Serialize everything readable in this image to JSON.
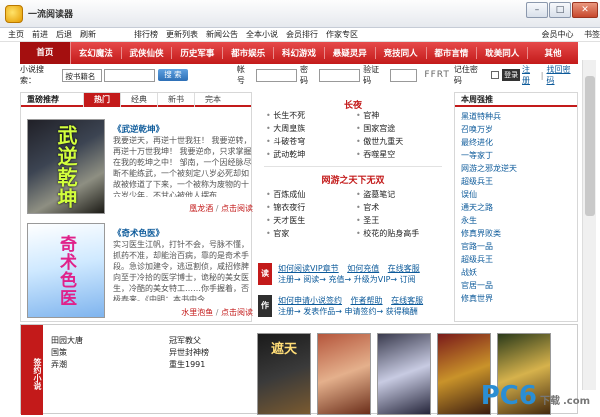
{
  "window": {
    "title": "一流阅读器"
  },
  "menubar": {
    "items": [
      "主页",
      "前进",
      "后退",
      "刷新",
      "排行榜",
      "更新列表",
      "新闻公告",
      "全本小说",
      "会员排行",
      "作家专区"
    ],
    "right_items": [
      "会员中心",
      "书签"
    ]
  },
  "nav": {
    "items": [
      "首页",
      "玄幻魔法",
      "武侠仙侠",
      "历史军事",
      "都市娱乐",
      "科幻游戏",
      "悬疑灵异",
      "竞技同人",
      "都市言情",
      "耽美同人",
      "其他"
    ]
  },
  "search": {
    "label": "小说搜索：",
    "select_value": "按书籍名",
    "button": "搜 索",
    "account_label": "帐号",
    "password_label": "密码",
    "verify_label": "验证码",
    "captcha": "FFRT",
    "remember_label": "记住密码",
    "login_button": "登录",
    "register_link": "注册",
    "forgot_link": "找回密码"
  },
  "recommend": {
    "title": "重磅推荐",
    "tabs": [
      "热门",
      "经典",
      "新书",
      "完本"
    ],
    "books": [
      {
        "cover_title": "武逆乾坤",
        "title": "《武逆乾坤》",
        "desc": "我要逆天，再逆十世我狂！ 我要逆转，再逆十万世我坤！ 我要逆命，只求掌握在我的乾坤之中！ 邹南，一个因经脉尽断不能练武，一个被刻定八岁必死却如故被修道了下来，一个被称为废物的十六岁少年，不甘心被他人摆布……",
        "author": "凰龙酒",
        "read": "点击阅读"
      },
      {
        "cover_title": "奇术色医",
        "title": "《奇术色医》",
        "desc": "实习医生江帆，打针不会，号脉不懂，抓药不准，却能治百病，靠的是奇术手段。急诊加建令，逃逗割侦，咸招修脾向至于冷拾的医学博士，诡秘的美女医生，冷酷的美女特工……你手握着，否极泰来。《中明：本书中今……",
        "author": "水里泡鱼",
        "read": "点击阅读"
      }
    ]
  },
  "middle": {
    "top_title": "长夜",
    "top_list": [
      "长生不死",
      "官神",
      "大周皇族",
      "国家宫途",
      "斗破苍穹",
      "傲世九重天",
      "武动乾坤",
      "吞噬星空"
    ],
    "mid_title": "网游之天下无双",
    "mid_list": [
      "百炼成仙",
      "盗墓笔记",
      "锦衣夜行",
      "官术",
      "天才医生",
      "圣王",
      "官家",
      "校花的贴身高手"
    ],
    "reader_tag": "读者",
    "reader_links": [
      "如何阅读VIP章节",
      "如何充值",
      "在线客服",
      "注册",
      "阅读",
      "充值",
      "升级为VIP",
      "订阅"
    ],
    "author_tag": "作者",
    "author_links": [
      "如何申请小说签约",
      "作者帮助",
      "在线客服",
      "注册",
      "发表作品",
      "申请签约",
      "获得稿酬"
    ]
  },
  "ranking": {
    "title": "本周强推",
    "items": [
      "黑道特种兵",
      "召唤万岁",
      "最终进化",
      "一等家丁",
      "网游之邪龙逆天",
      "超级兵王",
      "误仙",
      "通天之路",
      "永生",
      "修真界败类",
      "官路一品",
      "超级兵王",
      "战妖",
      "官居一品",
      "修真世界"
    ]
  },
  "bottom": {
    "tag": "签约小说",
    "list_a": [
      "田园大唐",
      "国策",
      "弄潮"
    ],
    "list_b": [
      "冠军教父",
      "异世封神榜",
      "重生1991"
    ],
    "thumbs": [
      "遮天",
      "",
      "",
      "",
      "",
      ""
    ]
  },
  "watermark": {
    "text": "PC6",
    "sub": "下载",
    "suffix": ".com"
  },
  "colors": {
    "accent": "#c31a1a",
    "link": "#0c5a9a",
    "scroll": "#c9c9c9"
  }
}
